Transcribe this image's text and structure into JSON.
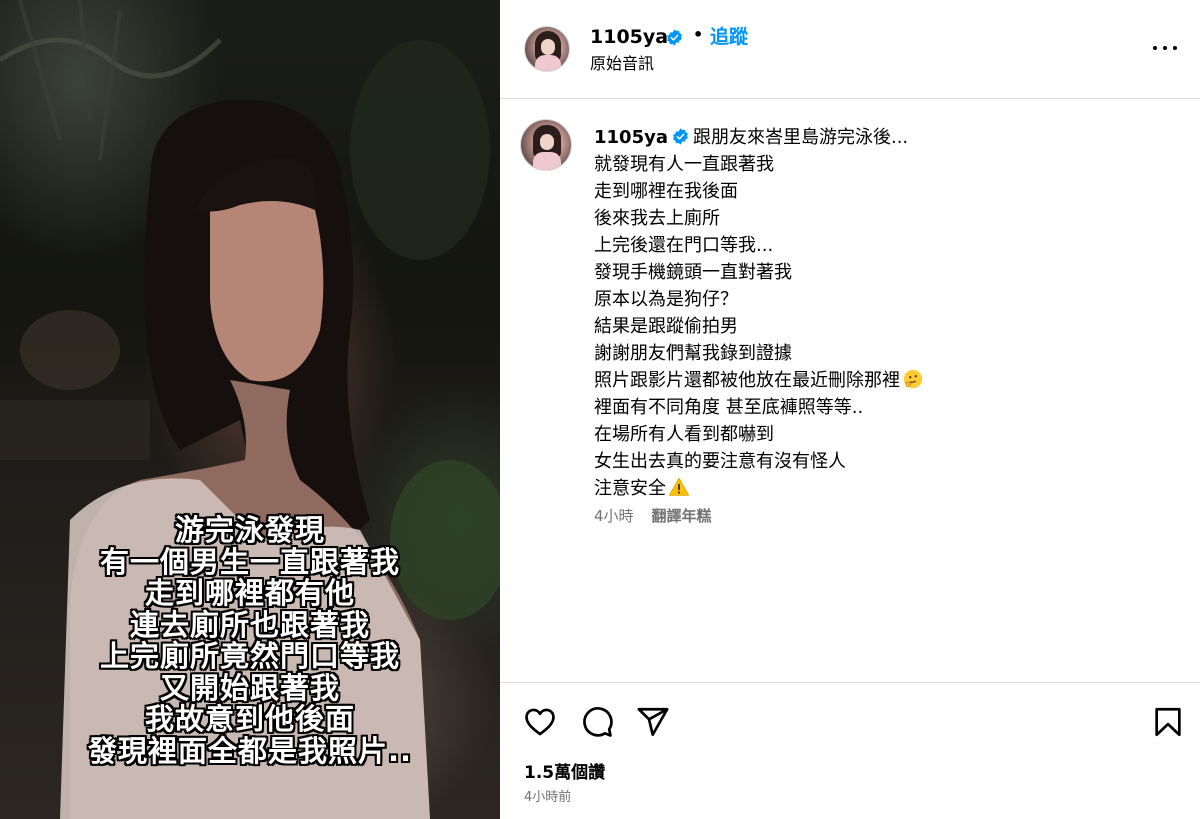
{
  "media": {
    "overlay_lines": [
      "游完泳發現",
      "有一個男生一直跟著我",
      "走到哪裡都有他",
      "連去廁所也跟著我",
      "上完廁所竟然門口等我",
      "又開始跟著我",
      "我故意到他後面",
      "發現裡面全都是我照片.."
    ]
  },
  "header": {
    "username": "1105ya",
    "dot": "•",
    "follow_label": "追蹤",
    "audio_label": "原始音訊"
  },
  "caption": {
    "username": "1105ya",
    "first_line": "跟朋友來峇里島游完泳後...",
    "lines": [
      "就發現有人一直跟著我",
      "走到哪裡在我後面",
      "後來我去上廁所",
      "上完後還在門口等我...",
      "發現手機鏡頭一直對著我",
      "原本以為是狗仔？",
      "結果是跟蹤偷拍男",
      "謝謝朋友們幫我錄到證據",
      "照片跟影片還都被他放在最近刪除那裡",
      "裡面有不同角度 甚至底褲照等等..",
      "在場所有人看到都嚇到",
      "女生出去真的要注意有沒有怪人",
      "注意安全"
    ],
    "time": "4小時",
    "translate_label": "翻譯年糕"
  },
  "footer": {
    "likes": "1.5萬個讚",
    "time": "4小時前"
  },
  "colors": {
    "accent": "#0095f6",
    "verified": "#0095f6",
    "muted": "#737373",
    "divider": "#dbdbdb"
  },
  "icons": [
    "verified-badge-icon",
    "more-options-icon",
    "heart-icon",
    "comment-icon",
    "share-icon",
    "bookmark-icon",
    "thinking-emoji-icon",
    "warning-emoji-icon"
  ]
}
